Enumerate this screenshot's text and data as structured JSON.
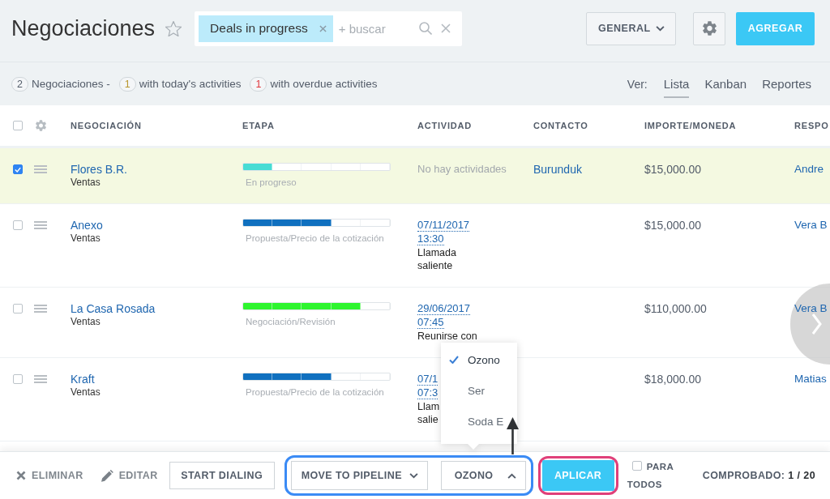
{
  "header": {
    "title": "Negociaciones",
    "favorite": false,
    "filter": {
      "tag": "Deals in progress",
      "placeholder": "+ buscar"
    },
    "category_button": "GENERAL",
    "add_button": "AGREGAR"
  },
  "summary": [
    {
      "count": "2",
      "label": "Negociaciones -",
      "color": "#535c69"
    },
    {
      "count": "1",
      "label": "with today's activities",
      "color": "#b8962e"
    },
    {
      "count": "1",
      "label": "with overdue activities",
      "color": "#e0353a"
    }
  ],
  "view": {
    "label": "Ver:",
    "tabs": [
      {
        "label": "Lista",
        "selected": true
      },
      {
        "label": "Kanban",
        "selected": false
      },
      {
        "label": "Reportes",
        "selected": false
      }
    ]
  },
  "table": {
    "select_all_checked": false,
    "columns": [
      "NEGOCIACIÓN",
      "ETAPA",
      "ACTIVIDAD",
      "CONTACTO",
      "IMPORTE/MONEDA",
      "RESPO"
    ],
    "rows": [
      {
        "selected": true,
        "name": "Flores B.R.",
        "pipeline": "Ventas",
        "stage": {
          "label": "En progreso",
          "level": 0.2,
          "color": "#47dcd4"
        },
        "activity": {
          "kind": "none",
          "text": "No hay actividades"
        },
        "contact": "Burunduk",
        "amount": "$15,000.00",
        "responsible": "Andre"
      },
      {
        "selected": false,
        "name": "Anexo",
        "pipeline": "Ventas",
        "stage": {
          "label": "Propuesta/Precio de la cotización",
          "level": 0.6,
          "color": "#1070bf"
        },
        "activity": {
          "kind": "scheduled",
          "date": "07/11/2017",
          "time": "13:30",
          "note": [
            "Llamada",
            "saliente"
          ]
        },
        "amount": "$15,000.00",
        "responsible": "Vera B"
      },
      {
        "selected": false,
        "name": "La Casa Rosada",
        "pipeline": "Ventas",
        "stage": {
          "label": "Negociación/Revisión",
          "level": 0.8,
          "color": "#2ef52e"
        },
        "activity": {
          "kind": "scheduled",
          "date": "29/06/2017",
          "time": "07:45",
          "note": [
            "Reunirse con"
          ]
        },
        "amount": "$110,000.00",
        "responsible": "Vera B"
      },
      {
        "selected": false,
        "name": "Kraft",
        "pipeline": "Ventas",
        "stage": {
          "label": "Propuesta/Precio de la cotización",
          "level": 0.6,
          "color": "#1070bf"
        },
        "activity": {
          "kind": "scheduled",
          "date": "07/1",
          "time": "07:3",
          "note": [
            "Llam",
            "salie"
          ]
        },
        "amount": "$18,000.00",
        "responsible": "Matias"
      }
    ]
  },
  "bottom_bar": {
    "delete_label": "ELIMINAR",
    "edit_label": "EDITAR",
    "dial_button": "START DIALING",
    "pipeline_select": {
      "value": "MOVE TO PIPELINE",
      "expanded": false
    },
    "stage_select": {
      "value": "OZONO",
      "expanded": true,
      "options": [
        {
          "label": "Ozono",
          "selected": true
        },
        {
          "label": "Ser",
          "selected": false
        },
        {
          "label": "Soda E",
          "selected": false
        }
      ]
    },
    "apply_button": "APLICAR",
    "for_all": {
      "label": "PARA TODOS",
      "checked": false
    },
    "counter": "COMPROBADO: **1 / 20**"
  }
}
